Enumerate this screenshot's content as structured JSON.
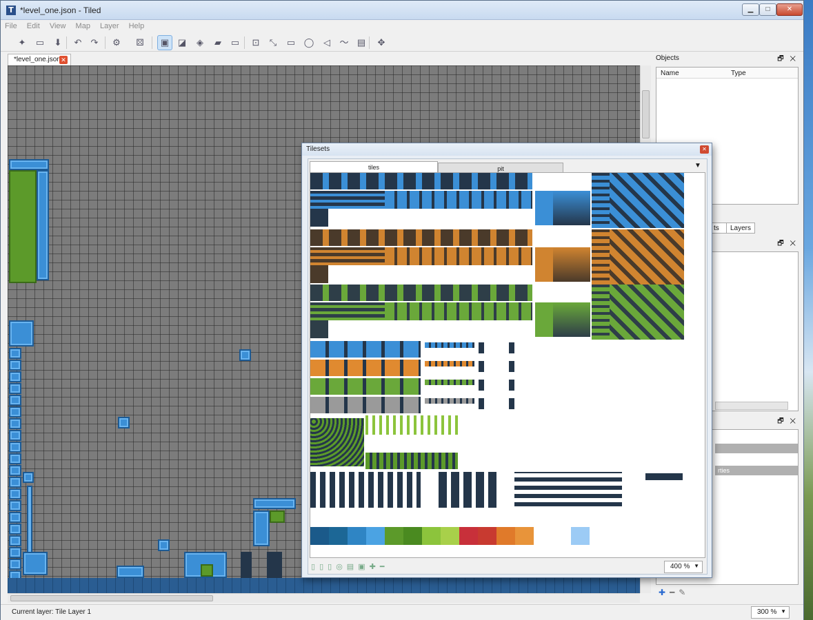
{
  "window": {
    "title": "*level_one.json - Tiled",
    "icon_glyph": "T",
    "minimize": "▁",
    "maximize": "□",
    "close": "✕"
  },
  "menu": [
    "File",
    "Edit",
    "View",
    "Map",
    "Layer",
    "Help"
  ],
  "toolbar": {
    "icons": [
      {
        "name": "new-map-icon",
        "glyph": "✦"
      },
      {
        "name": "open-icon",
        "glyph": "▭"
      },
      {
        "name": "save-icon",
        "glyph": "⬇"
      },
      {
        "name": "undo-icon",
        "glyph": "↶"
      },
      {
        "name": "redo-icon",
        "glyph": "↷"
      },
      {
        "name": "command-icon",
        "glyph": "⚙"
      },
      {
        "name": "random-icon",
        "glyph": "⚄"
      },
      {
        "name": "stamp-brush-icon",
        "glyph": "▣"
      },
      {
        "name": "terrain-brush-icon",
        "glyph": "◪"
      },
      {
        "name": "bucket-fill-icon",
        "glyph": "◈"
      },
      {
        "name": "eraser-icon",
        "glyph": "▰"
      },
      {
        "name": "rect-select-icon",
        "glyph": "▭"
      },
      {
        "name": "select-objects-icon",
        "glyph": "⊡"
      },
      {
        "name": "edit-polygons-icon",
        "glyph": "⤡"
      },
      {
        "name": "insert-rectangle-icon",
        "glyph": "▭"
      },
      {
        "name": "insert-ellipse-icon",
        "glyph": "◯"
      },
      {
        "name": "insert-polygon-icon",
        "glyph": "◁"
      },
      {
        "name": "insert-polyline-icon",
        "glyph": "〜"
      },
      {
        "name": "insert-tile-icon",
        "glyph": "▤"
      },
      {
        "name": "magic-wand-icon",
        "glyph": "✥"
      }
    ]
  },
  "document_tab": {
    "label": "*level_one.json",
    "close": "✕"
  },
  "status": {
    "current_layer": "Current layer: Tile Layer 1",
    "map_zoom": "300 %"
  },
  "objects_panel": {
    "title": "Objects",
    "columns": {
      "name": "Name",
      "type": "Type"
    },
    "dock_buttons": "🗗 ✕"
  },
  "side_tabs": {
    "partial": "ts",
    "layers": "Layers"
  },
  "panel2": {
    "dock_buttons": "🗗 ✕"
  },
  "panel3": {
    "dock_buttons": "🗗 ✕",
    "partial_item": "rties"
  },
  "tilesets": {
    "title": "Tilesets",
    "close": "✕",
    "tabs": [
      {
        "label": "tiles"
      },
      {
        "label": "pit"
      }
    ],
    "dropdown": "▼",
    "zoom": "400 %",
    "zoom_arrow": "▼",
    "palette": [
      "#1b5a8a",
      "#1c6796",
      "#2f85c4",
      "#4ba3e3",
      "#5c9a2a",
      "#4a8a20",
      "#8cc43c",
      "#a8d04a",
      "#c8303a",
      "#c83a30",
      "#e07a2a",
      "#e8943a",
      "#ffffff",
      "#ffffff",
      "#9ccbf5"
    ]
  },
  "colors": {
    "blue": "#3b8fd6",
    "orange": "#c07028",
    "green": "#5c9a2a",
    "dark": "#24364a"
  }
}
